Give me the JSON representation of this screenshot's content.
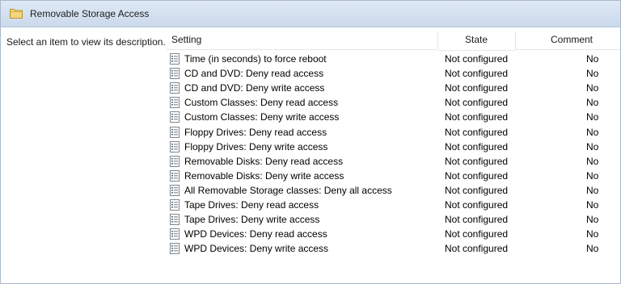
{
  "header": {
    "title": "Removable Storage Access",
    "icon": "folder-icon"
  },
  "description": "Select an item to view its description.",
  "columns": {
    "setting": "Setting",
    "state": "State",
    "comment": "Comment"
  },
  "rows": [
    {
      "setting": "Time (in seconds) to force reboot",
      "state": "Not configured",
      "comment": "No"
    },
    {
      "setting": "CD and DVD: Deny read access",
      "state": "Not configured",
      "comment": "No"
    },
    {
      "setting": "CD and DVD: Deny write access",
      "state": "Not configured",
      "comment": "No"
    },
    {
      "setting": "Custom Classes: Deny read access",
      "state": "Not configured",
      "comment": "No"
    },
    {
      "setting": "Custom Classes: Deny write access",
      "state": "Not configured",
      "comment": "No"
    },
    {
      "setting": "Floppy Drives: Deny read access",
      "state": "Not configured",
      "comment": "No"
    },
    {
      "setting": "Floppy Drives: Deny write access",
      "state": "Not configured",
      "comment": "No"
    },
    {
      "setting": "Removable Disks: Deny read access",
      "state": "Not configured",
      "comment": "No"
    },
    {
      "setting": "Removable Disks: Deny write access",
      "state": "Not configured",
      "comment": "No"
    },
    {
      "setting": "All Removable Storage classes: Deny all access",
      "state": "Not configured",
      "comment": "No"
    },
    {
      "setting": "Tape Drives: Deny read access",
      "state": "Not configured",
      "comment": "No"
    },
    {
      "setting": "Tape Drives: Deny write access",
      "state": "Not configured",
      "comment": "No"
    },
    {
      "setting": "WPD Devices: Deny read access",
      "state": "Not configured",
      "comment": "No"
    },
    {
      "setting": "WPD Devices: Deny write access",
      "state": "Not configured",
      "comment": "No"
    }
  ],
  "row_icon": "policy-setting-icon",
  "colors": {
    "header_bg": "#cad9ec",
    "border": "#a9b8cc",
    "folder": "#e8c25a"
  }
}
